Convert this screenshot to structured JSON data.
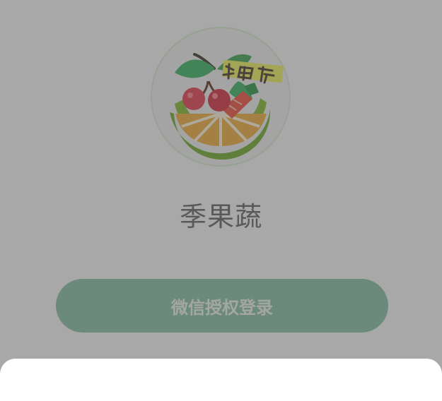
{
  "app": {
    "name": "季果蔬",
    "logo_text": "季果蔬"
  },
  "login": {
    "button_label": "微信授权登录"
  },
  "colors": {
    "button_bg": "#8fc3a9",
    "overlay": "rgba(60,60,60,0.42)",
    "logo_green": "#8cbf3f",
    "logo_orange": "#f2b24a"
  },
  "icons": {
    "logo": "fruit-vegetable-logo"
  }
}
